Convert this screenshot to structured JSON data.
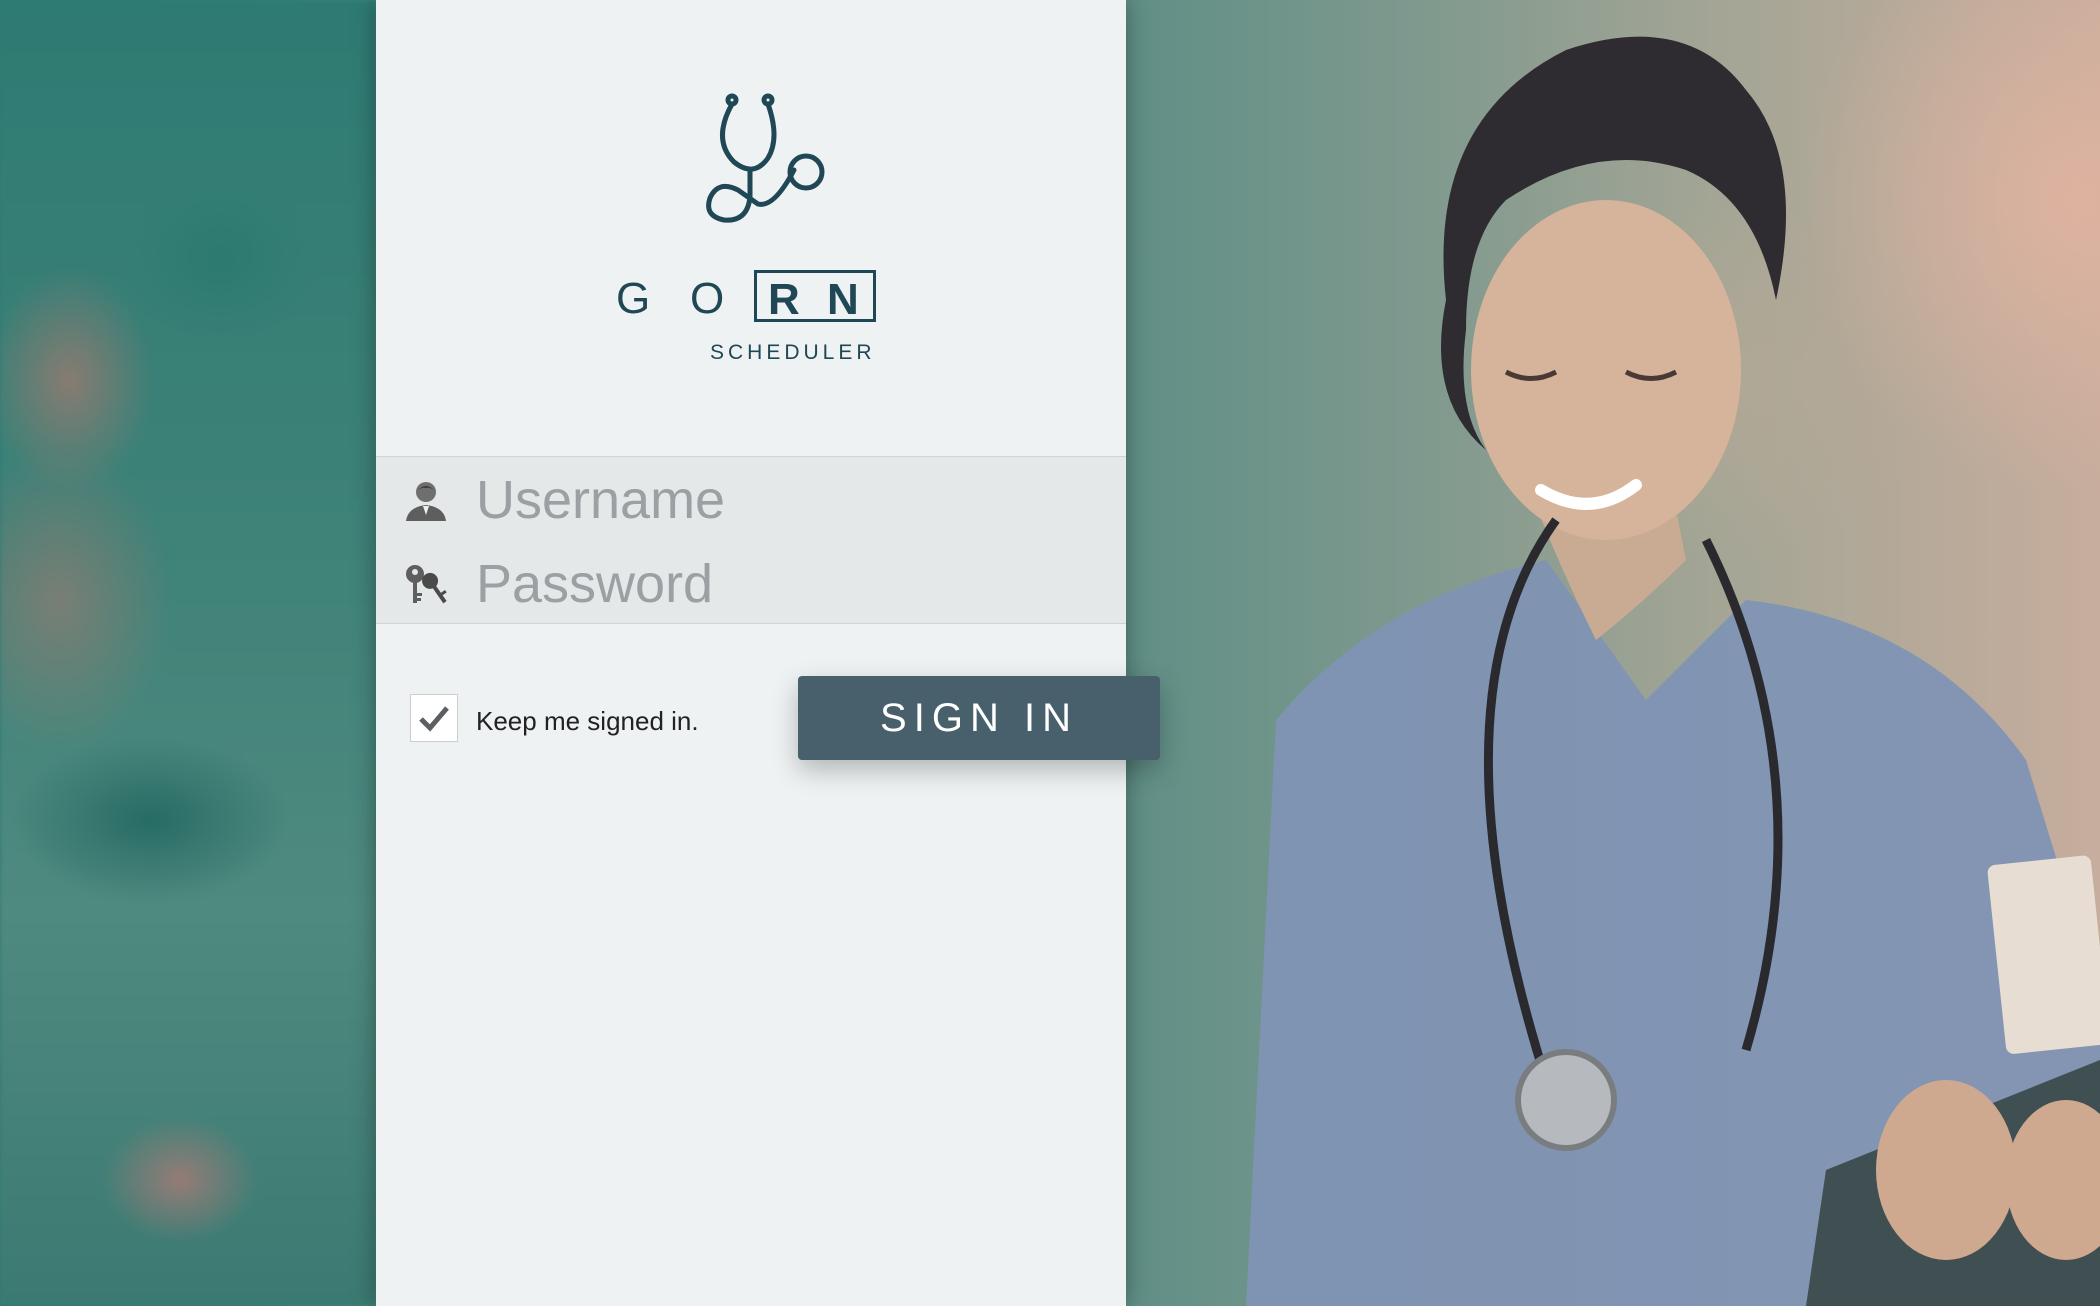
{
  "brand": {
    "letters": [
      "G",
      "O",
      "R",
      "N"
    ],
    "subtitle": "SCHEDULER"
  },
  "login": {
    "username_placeholder": "Username",
    "username_value": "",
    "password_placeholder": "Password",
    "password_value": "",
    "remember_label": "Keep me signed in.",
    "remember_checked": true,
    "signin_label": "SIGN IN"
  },
  "icons": {
    "logo": "stethoscope-icon",
    "username": "user-icon",
    "password": "key-icon",
    "remember": "checkmark-icon"
  },
  "colors": {
    "brand": "#1f4756",
    "button": "#47606b",
    "panel": "#eef2f2"
  }
}
